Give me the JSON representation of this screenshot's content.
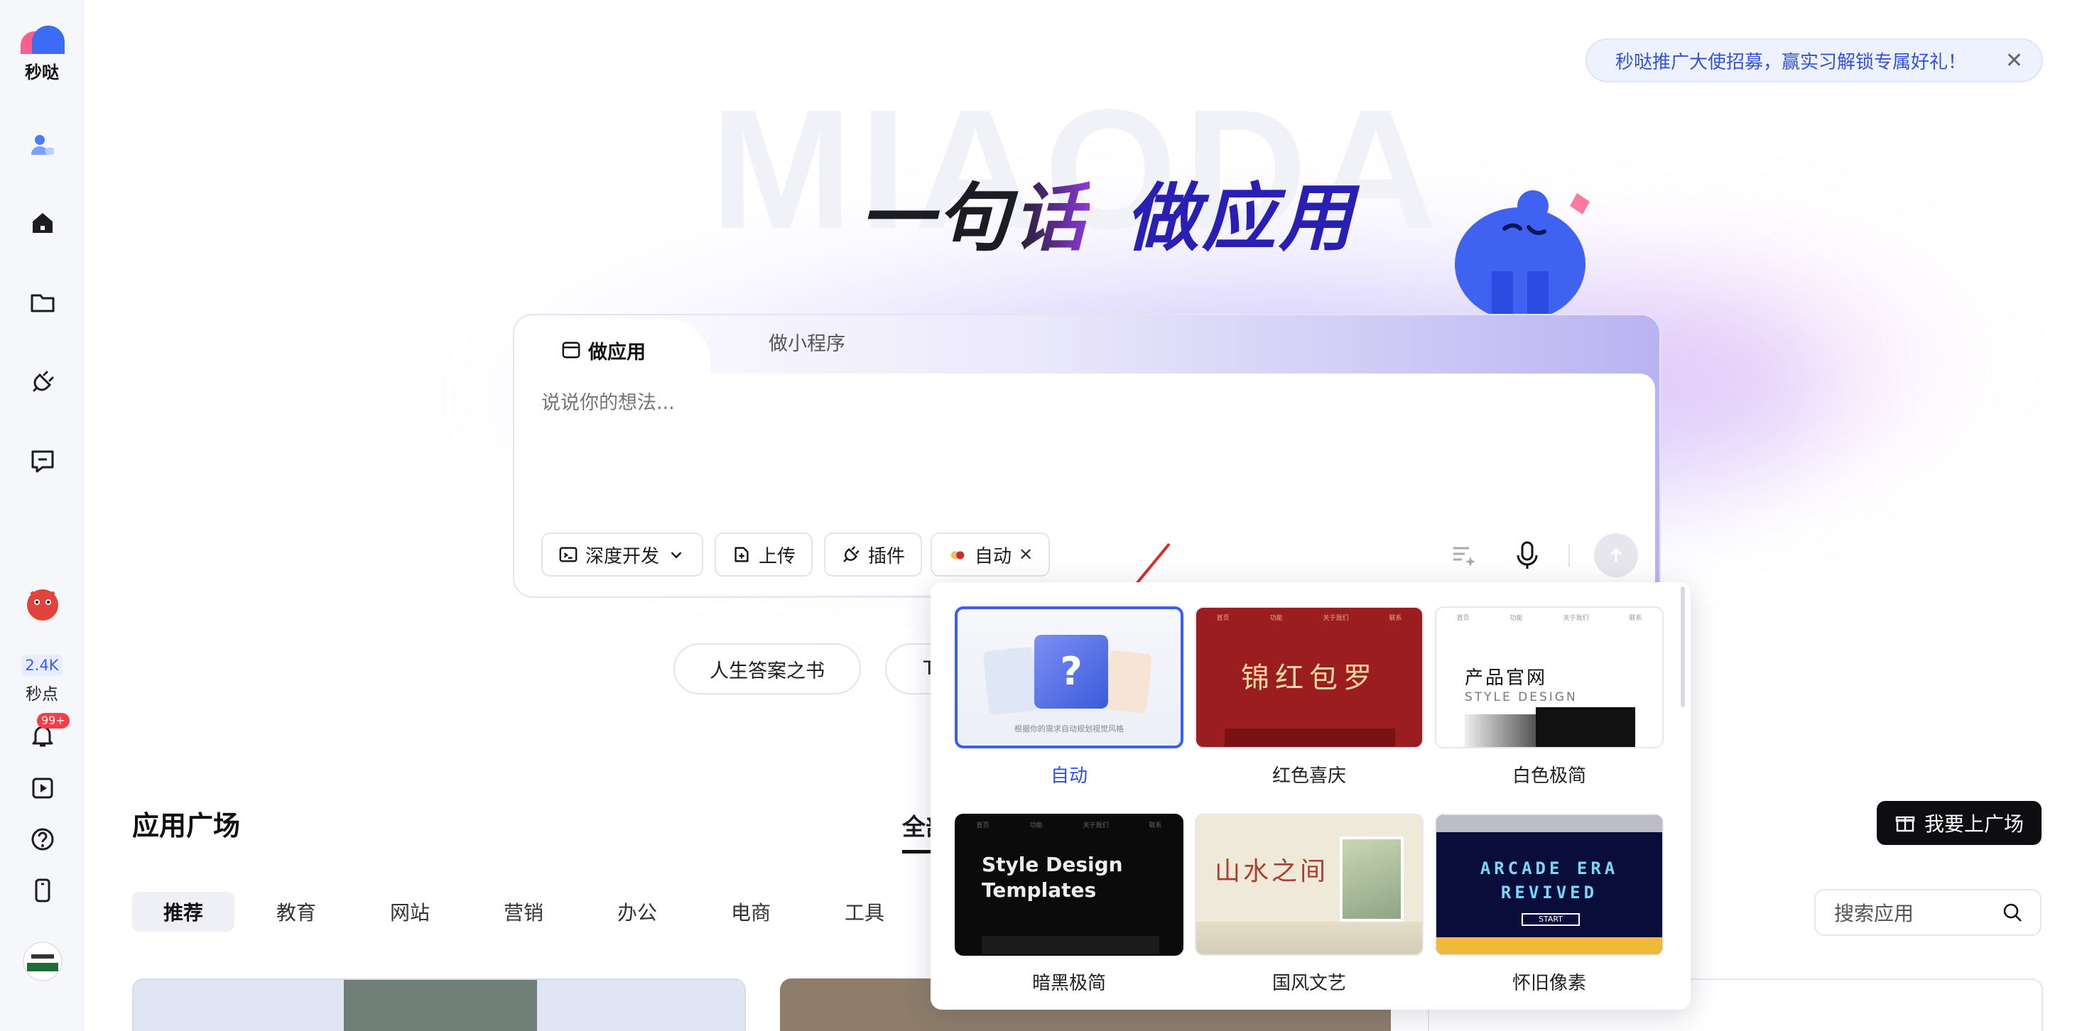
{
  "app": {
    "name": "秒哒",
    "badge_count": "2.4K",
    "badge_unit": "秒点",
    "notif": "99+"
  },
  "banner": {
    "text": "秒哒推广大使招募，赢实习解锁专属好礼！",
    "close": "✕"
  },
  "hero": {
    "bg_word": "MIAODA",
    "h1": "一句",
    "h2": "话",
    "h3": "做应用"
  },
  "composer": {
    "tab_active": "做应用",
    "tab_other": "做小程序",
    "placeholder": "说说你的想法...",
    "chip_dev": "深度开发",
    "chip_upload": "上传",
    "chip_plugin": "插件",
    "chip_style": "自动"
  },
  "quick": {
    "q1": "人生答案之书",
    "q2": "T"
  },
  "plaza": {
    "title": "应用广场",
    "all": "全部",
    "cta": "我要上广场",
    "search": "搜索应用",
    "categories": [
      "推荐",
      "教育",
      "网站",
      "营销",
      "办公",
      "电商",
      "工具"
    ]
  },
  "styles": [
    {
      "label": "自动",
      "caption": "根据你的需求自动规划视觉风格",
      "selected": true
    },
    {
      "label": "红色喜庆",
      "title": "锦红包罗"
    },
    {
      "label": "白色极简",
      "title": "产品官网",
      "sub": "STYLE DESIGN"
    },
    {
      "label": "暗黑极简",
      "title": "Style Design Templates"
    },
    {
      "label": "国风文艺",
      "title": "山水之间"
    },
    {
      "label": "怀旧像素",
      "title": "ARCADE ERA REVIVED",
      "sub": "START"
    }
  ],
  "thumb_nav": [
    "首页",
    "功能",
    "关于我们",
    "联系"
  ],
  "colors": {
    "accent": "#3d5cf2",
    "brand_dark": "#2a1fb4",
    "sidebar_bg": "#f6f7fb"
  }
}
